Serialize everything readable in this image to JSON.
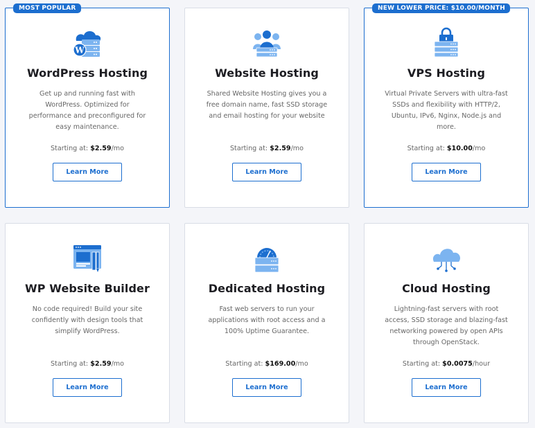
{
  "colors": {
    "accent": "#1c6ecf",
    "icon_light": "#7cb4f0"
  },
  "cards": [
    {
      "badge": "MOST POPULAR",
      "icon": "wordpress-cloud-server-icon",
      "title": "WordPress Hosting",
      "description": "Get up and running fast with WordPress. Optimized for performance and preconfigured for easy maintenance.",
      "price_prefix": "Starting at: ",
      "price": "$2.59",
      "price_suffix": "/mo",
      "button": "Learn More"
    },
    {
      "badge": "",
      "icon": "team-server-icon",
      "title": "Website Hosting",
      "description": "Shared Website Hosting gives you a free domain name, fast SSD storage and email hosting for your website",
      "price_prefix": "Starting at: ",
      "price": "$2.59",
      "price_suffix": "/mo",
      "button": "Learn More"
    },
    {
      "badge": "NEW LOWER PRICE: $10.00/MONTH",
      "icon": "lock-server-icon",
      "title": "VPS Hosting",
      "description": "Virtual Private Servers with ultra-fast SSDs and flexibility with HTTP/2, Ubuntu, IPv6, Nginx, Node.js and more.",
      "price_prefix": "Starting at: ",
      "price": "$10.00",
      "price_suffix": "/mo",
      "button": "Learn More"
    },
    {
      "badge": "",
      "icon": "website-builder-icon",
      "title": "WP Website Builder",
      "description": "No code required! Build your site confidently with design tools that simplify WordPress.",
      "price_prefix": "Starting at: ",
      "price": "$2.59",
      "price_suffix": "/mo",
      "button": "Learn More"
    },
    {
      "badge": "",
      "icon": "speedometer-server-icon",
      "title": "Dedicated Hosting",
      "description": "Fast web servers to run your applications with root access and a 100% Uptime Guarantee.",
      "price_prefix": "Starting at: ",
      "price": "$169.00",
      "price_suffix": "/mo",
      "button": "Learn More"
    },
    {
      "badge": "",
      "icon": "cloud-network-icon",
      "title": "Cloud Hosting",
      "description": "Lightning-fast servers with root access, SSD storage and blazing-fast networking powered by open APIs through OpenStack.",
      "price_prefix": "Starting at: ",
      "price": "$0.0075",
      "price_suffix": "/hour",
      "button": "Learn More"
    }
  ]
}
